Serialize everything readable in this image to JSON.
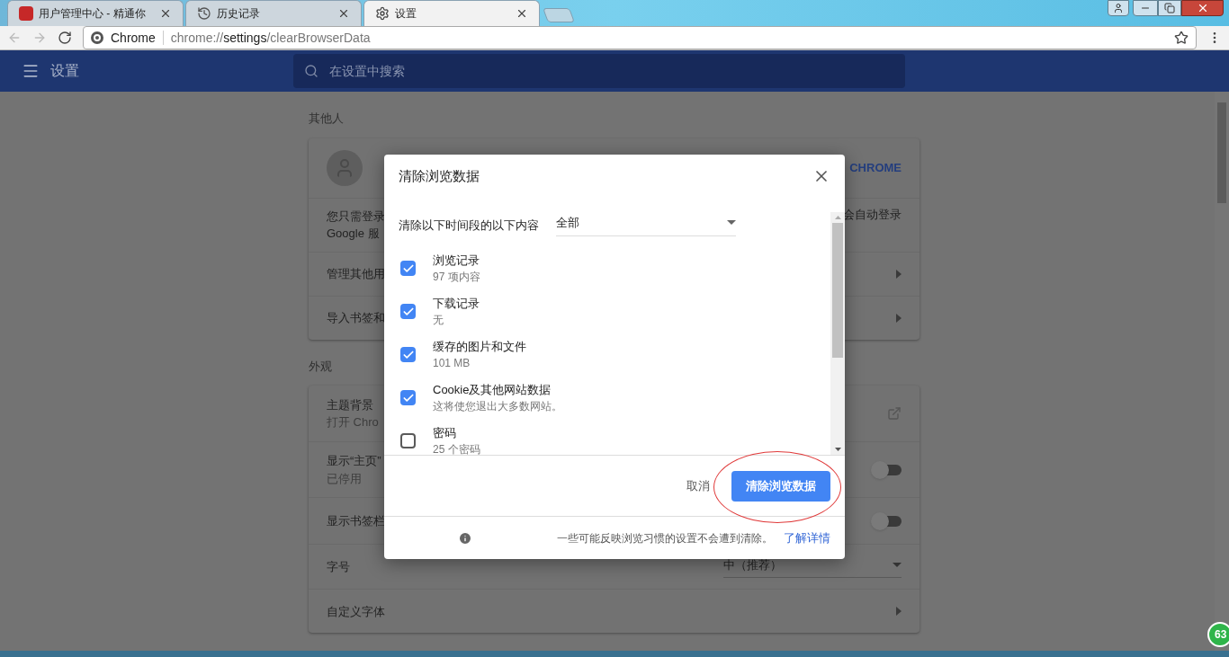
{
  "tabs": [
    {
      "kind": "site",
      "title": "用户管理中心 - 精通你",
      "selected": false
    },
    {
      "kind": "history",
      "title": "历史记录",
      "selected": false
    },
    {
      "kind": "settings",
      "title": "设置",
      "selected": true
    }
  ],
  "toolbar": {
    "site_name": "Chrome",
    "url_scheme": "chrome://",
    "url_host": "settings",
    "url_path": "/clearBrowserData"
  },
  "header": {
    "title": "设置",
    "search_placeholder": "在设置中搜索"
  },
  "sections": [
    {
      "title": "其他人",
      "rows": [
        {
          "kind": "profile",
          "action": "CHROME"
        },
        {
          "kind": "text",
          "label": "您只需登录",
          "sublabel": "Google 服",
          "right": "会自动登录"
        },
        {
          "kind": "arrow",
          "label": "管理其他用"
        },
        {
          "kind": "arrow",
          "label": "导入书签和"
        }
      ]
    },
    {
      "title": "外观",
      "rows": [
        {
          "kind": "external",
          "label": "主题背景",
          "sublabel": "打开 Chro"
        },
        {
          "kind": "toggle",
          "label": "显示“主页”",
          "sublabel": "已停用",
          "on": false
        },
        {
          "kind": "toggle",
          "label": "显示书签栏",
          "on": false
        },
        {
          "kind": "select",
          "label": "字号",
          "value": "中（推荐）"
        },
        {
          "kind": "arrow",
          "label": "自定义字体"
        }
      ]
    }
  ],
  "dialog": {
    "title": "清除浏览数据",
    "range_label": "清除以下时间段的以下内容",
    "range_value": "全部",
    "items": [
      {
        "label": "浏览记录",
        "detail": "97 项内容",
        "checked": true
      },
      {
        "label": "下载记录",
        "detail": "无",
        "checked": true
      },
      {
        "label": "缓存的图片和文件",
        "detail": "101 MB",
        "checked": true
      },
      {
        "label": "Cookie及其他网站数据",
        "detail": "这将使您退出大多数网站。",
        "checked": true
      },
      {
        "label": "密码",
        "detail": "25 个密码",
        "checked": false
      }
    ],
    "cancel": "取消",
    "confirm": "清除浏览数据",
    "footer_note": "一些可能反映浏览习惯的设置不会遭到清除。",
    "footer_link": "了解详情"
  },
  "badge": "63"
}
